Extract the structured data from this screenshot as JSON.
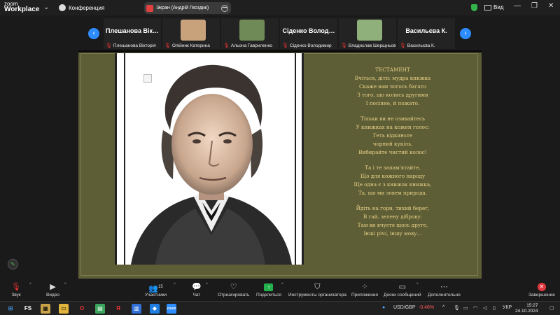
{
  "app": {
    "logo_line1": "zoom",
    "logo_line2": "Workplace",
    "meeting_label": "Конференция",
    "screen_pill": "Экран (Андрій Гвоздик)",
    "view_label": "Вид",
    "win_min": "—",
    "win_max": "❐",
    "win_close": "✕"
  },
  "participants": [
    {
      "display": "Плешанова  Вік…",
      "name": "Плешанова Вікторія",
      "photo": false
    },
    {
      "display": "",
      "name": "Олійник Катерина",
      "photo": true,
      "photo_color": "#c7a27a"
    },
    {
      "display": "",
      "name": "Альона Гавриленко",
      "photo": true,
      "photo_color": "#6f8a57"
    },
    {
      "display": "Сіденко  Волод…",
      "name": "Сіденко Володимир",
      "photo": false
    },
    {
      "display": "",
      "name": "Владислав Шерщньов",
      "photo": true,
      "photo_color": "#8fb07a"
    },
    {
      "display": "Васильєва  К.",
      "name": "Васильєва К.",
      "photo": false
    }
  ],
  "poem": {
    "title": "ТЕСТАМЕНТ",
    "stanzas": [
      [
        "Вчіться, діти: мудра книжка",
        "Скаже вам чогось багато",
        "З того, що колись другими",
        "І посіяно, й пожато."
      ],
      [
        "Тільки ви не озивайтесь",
        "У книжках на кожен голос:",
        "Геть відкиньте",
        "чорний кукіль,",
        "Вибирайте чистий колос!"
      ],
      [
        "Та і те запам'ятайте,",
        "Що для кожного народу",
        "Ще одна є з книжок книжка,",
        "Та, що ми зовем природа."
      ],
      [
        "Йдіть на гори, тихий берег,",
        "В гай, зелену діброву:",
        "Там ви вчуєте щось друге,",
        "Інші річі, іншу мову…"
      ]
    ]
  },
  "toolbar": {
    "audio": "Звук",
    "video": "Видео",
    "participants": "Участники",
    "participants_count": "15",
    "chat": "Чат",
    "react": "Отреагировать",
    "share": "Поделиться",
    "host_tools": "Инструменты организатора",
    "apps": "Приложения",
    "whiteboards": "Доски сообщений",
    "more": "Дополнительно",
    "end": "Завершение"
  },
  "taskbar": {
    "fs": "FS",
    "ticker": "USD/GBP",
    "ticker_change": "-0.48%",
    "lang": "УКР",
    "time": "15:27",
    "date": "24.10.2024",
    "colors": {
      "negative": "#ff5a5a"
    }
  },
  "colors": {
    "accent": "#2d8cff",
    "board": "#5d5e36",
    "poem_text": "#e8cf86",
    "end": "#e0383e",
    "share": "#22b14c"
  }
}
